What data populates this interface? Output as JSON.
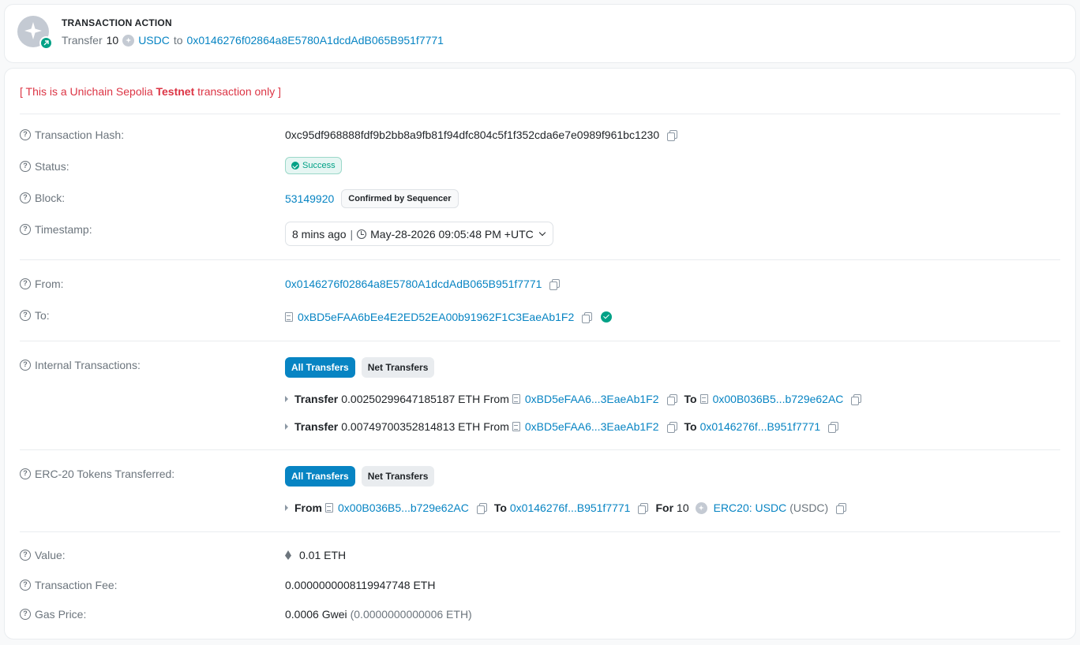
{
  "action": {
    "title": "TRANSACTION ACTION",
    "verb": "Transfer",
    "amount": "10",
    "token": "USDC",
    "to_word": "to",
    "to_address": "0x0146276f02864a8E5780A1dcdAdB065B951f7771"
  },
  "notice": {
    "prefix": "[ This is a Unichain Sepolia ",
    "bold": "Testnet",
    "suffix": " transaction only ]"
  },
  "labels": {
    "hash": "Transaction Hash:",
    "status": "Status:",
    "block": "Block:",
    "timestamp": "Timestamp:",
    "from": "From:",
    "to": "To:",
    "internal": "Internal Transactions:",
    "erc20": "ERC-20 Tokens Transferred:",
    "value": "Value:",
    "fee": "Transaction Fee:",
    "gas": "Gas Price:"
  },
  "tx": {
    "hash": "0xc95df968888fdf9b2bb8a9fb81f94dfc804c5f1f352cda6e7e0989f961bc1230",
    "status": "Success",
    "block": "53149920",
    "block_badge": "Confirmed by Sequencer",
    "time_ago": "8 mins ago",
    "separator": "|",
    "datetime": "May-28-2026 09:05:48 PM +UTC",
    "from": "0x0146276f02864a8E5780A1dcdAdB065B951f7771",
    "to": "0xBD5eFAA6bEe4E2ED52EA00b91962F1C3EaeAb1F2",
    "value": "0.01 ETH",
    "fee": "0.0000000008119947748 ETH",
    "gas_gwei": "0.0006 Gwei",
    "gas_eth": "(0.0000000000006 ETH)"
  },
  "tabs": {
    "all": "All Transfers",
    "net": "Net Transfers"
  },
  "words": {
    "transfer": "Transfer",
    "from": "From",
    "to": "To",
    "for": "For"
  },
  "internal": [
    {
      "amount": "0.00250299647185187 ETH",
      "from": "0xBD5eFAA6...3EaeAb1F2",
      "to": "0x00B036B5...b729e62AC"
    },
    {
      "amount": "0.00749700352814813 ETH",
      "from": "0xBD5eFAA6...3EaeAb1F2",
      "to": "0x0146276f...B951f7771"
    }
  ],
  "erc20": {
    "from": "0x00B036B5...b729e62AC",
    "to": "0x0146276f...B951f7771",
    "amount": "10",
    "token": "ERC20: USDC",
    "symbol": "(USDC)"
  }
}
